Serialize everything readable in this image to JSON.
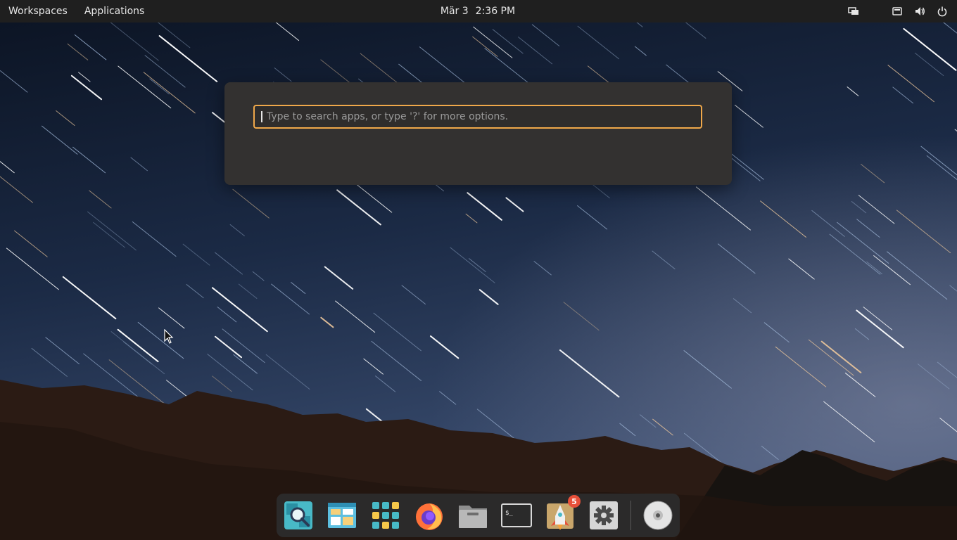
{
  "top_panel": {
    "workspaces_label": "Workspaces",
    "applications_label": "Applications",
    "date": "Mär 3",
    "time": "2:36 PM",
    "tray_icons": [
      "screen-share-icon",
      "keyboard-icon",
      "volume-icon",
      "power-icon"
    ]
  },
  "launcher": {
    "search_placeholder": "Type to search apps, or type '?' for more options.",
    "search_value": ""
  },
  "dock": {
    "items": [
      {
        "name": "search-app-icon"
      },
      {
        "name": "file-browser-icon"
      },
      {
        "name": "app-grid-icon"
      },
      {
        "name": "firefox-icon"
      },
      {
        "name": "files-icon"
      },
      {
        "name": "terminal-icon",
        "text": "$_"
      },
      {
        "name": "pop-shop-icon",
        "badge": "5"
      },
      {
        "name": "settings-icon"
      },
      {
        "name": "optical-disc-icon"
      }
    ]
  },
  "colors": {
    "panel_bg": "#1f1f1f",
    "launcher_bg": "#333130",
    "accent": "#f0a84a",
    "badge": "#e8503a"
  }
}
